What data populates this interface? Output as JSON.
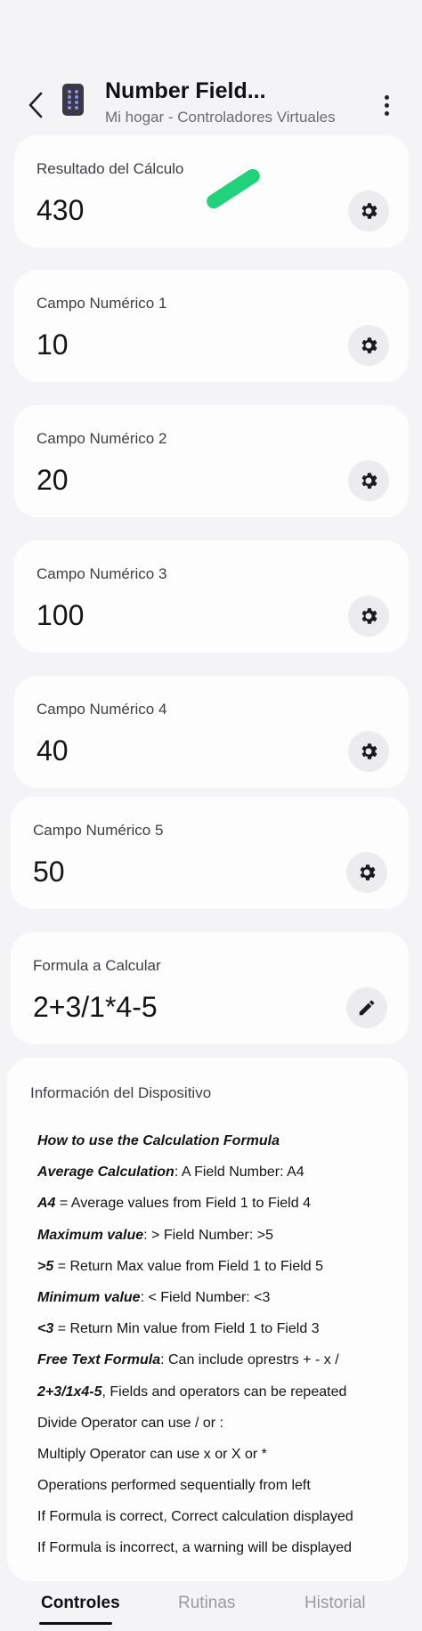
{
  "header": {
    "title": "Number Field...",
    "subtitle": "Mi hogar - Controladores Virtuales"
  },
  "cards": [
    {
      "label": "Resultado del Cálculo",
      "value": "430"
    },
    {
      "label": "Campo Numérico 1",
      "value": "10"
    },
    {
      "label": "Campo Numérico 2",
      "value": "20"
    },
    {
      "label": "Campo Numérico 3",
      "value": "100"
    },
    {
      "label": "Campo Numérico 4",
      "value": "40"
    },
    {
      "label": "Campo Numérico 5",
      "value": "50"
    },
    {
      "label": "Formula a Calcular",
      "value": "2+3/1*4-5"
    }
  ],
  "info": {
    "title": "Información del Dispositivo",
    "lines": [
      {
        "bold": "How to use the Calculation Formula",
        "text": ""
      },
      {
        "bold": "Average Calculation",
        "text": ": A Field Number: A4"
      },
      {
        "bold": "A4",
        "text": " = Average values from Field 1 to Field 4"
      },
      {
        "bold": "Maximum value",
        "text": ": > Field Number: >5"
      },
      {
        "bold": ">5",
        "text": " = Return Max value from Field 1 to Field 5"
      },
      {
        "bold": "Minimum value",
        "text": ": < Field Number: <3"
      },
      {
        "bold": "<3",
        "text": " = Return Min value from Field 1 to Field 3"
      },
      {
        "bold": "Free Text Formula",
        "text": ": Can include oprestrs + - x /"
      },
      {
        "bold": "2+3/1x4-5",
        "text": ", Fields and operators can be repeated"
      },
      {
        "bold": "",
        "text": "Divide Operator can use / or :"
      },
      {
        "bold": "",
        "text": "Multiply Operator can use x or X or *"
      },
      {
        "bold": "",
        "text": "Operations performed sequentially from left"
      },
      {
        "bold": "",
        "text": "If Formula is correct, Correct calculation displayed"
      },
      {
        "bold": "",
        "text": "If Formula is incorrect, a warning will be displayed"
      }
    ]
  },
  "tabs": [
    {
      "label": "Controles",
      "active": true
    },
    {
      "label": "Rutinas",
      "active": false
    },
    {
      "label": "Historial",
      "active": false
    }
  ],
  "icons": {
    "back": "chevron-left-icon",
    "device": "remote-device-icon",
    "more": "more-vertical-icon",
    "settings": "gear-icon",
    "edit": "pencil-icon"
  },
  "colors": {
    "accent_mark": "#1fd37a",
    "background": "#f4f4f7",
    "card": "#fdfdfe"
  }
}
